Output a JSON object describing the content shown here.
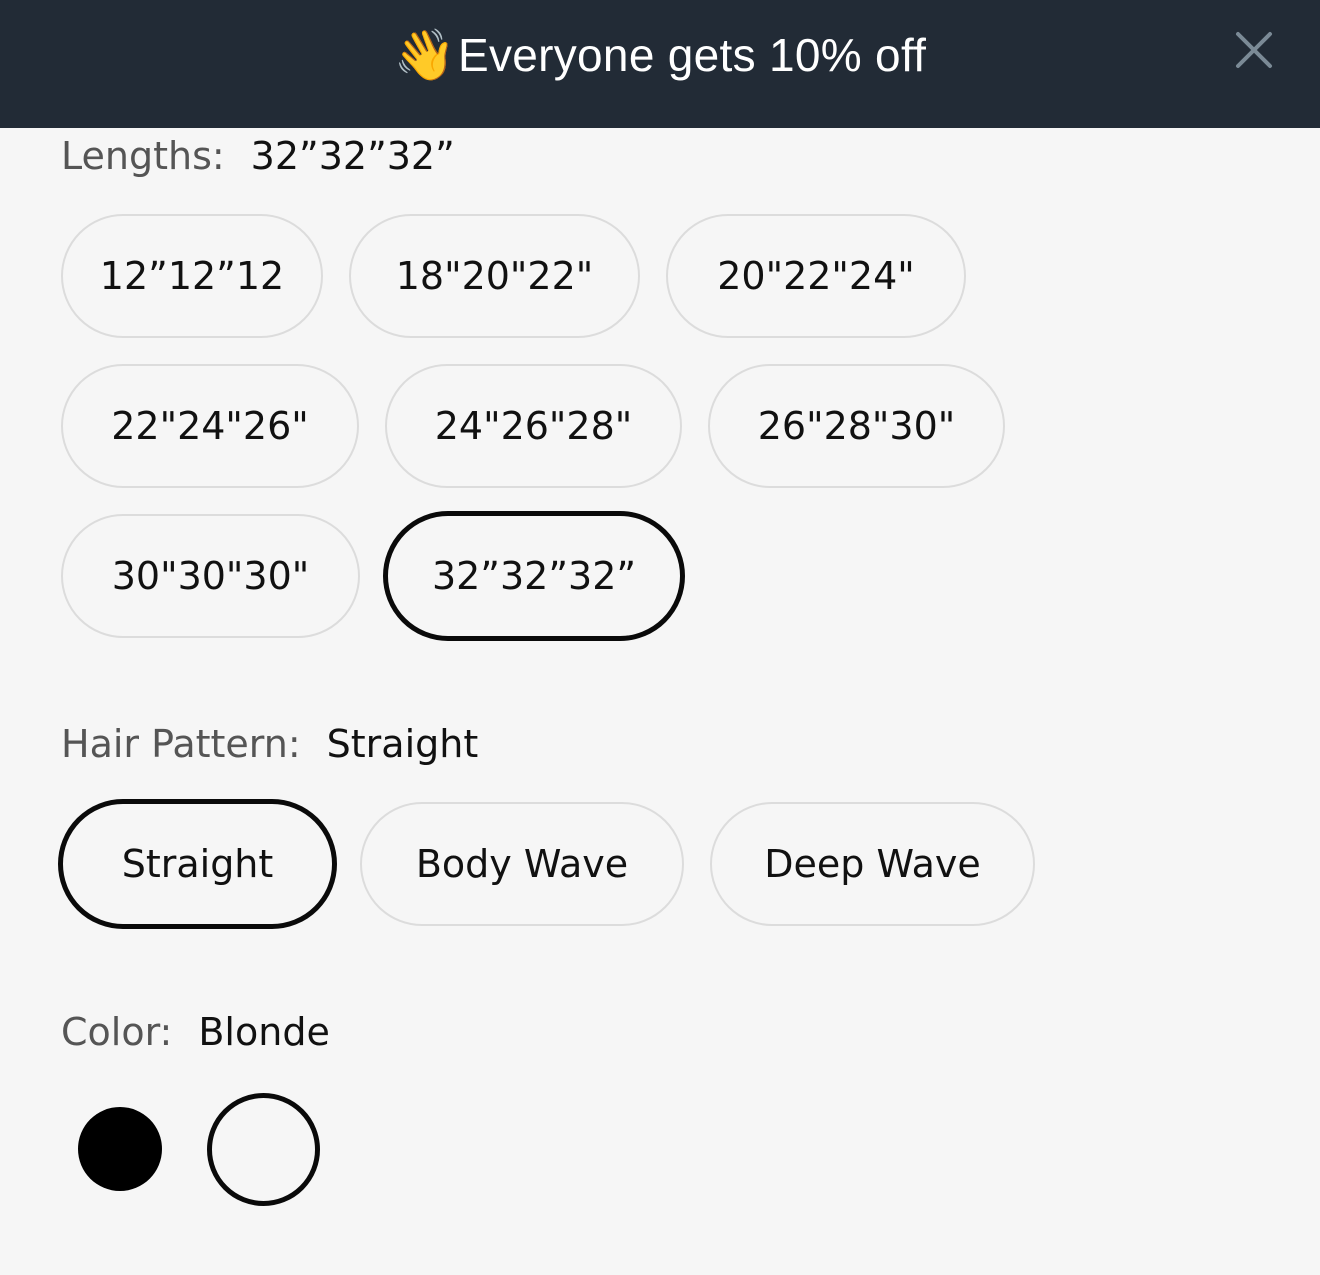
{
  "announcement": {
    "icon": "waving-hand-icon",
    "text": "Everyone gets 10% off",
    "close_icon": "close-icon",
    "background": "#222b36"
  },
  "lengths": {
    "label": "Lengths:",
    "selected_value": "32”32”32”",
    "options": [
      {
        "label": "12”12”12",
        "selected": false
      },
      {
        "label": "18\"20\"22\"",
        "selected": false
      },
      {
        "label": "20\"22\"24\"",
        "selected": false
      },
      {
        "label": "22\"24\"26\"",
        "selected": false
      },
      {
        "label": "24\"26\"28\"",
        "selected": false
      },
      {
        "label": "26\"28\"30\"",
        "selected": false
      },
      {
        "label": "30\"30\"30\"",
        "selected": false
      },
      {
        "label": "32”32”32”",
        "selected": true
      }
    ]
  },
  "hair_pattern": {
    "label": "Hair Pattern:",
    "selected_value": "Straight",
    "options": [
      {
        "label": "Straight",
        "selected": true
      },
      {
        "label": "Body Wave",
        "selected": false
      },
      {
        "label": "Deep Wave",
        "selected": false
      }
    ]
  },
  "color": {
    "label": "Color:",
    "selected_value": "Blonde",
    "swatches": [
      {
        "color": "#000000",
        "selected": false
      },
      {
        "color": "#f6f6f6",
        "selected": true
      }
    ]
  }
}
